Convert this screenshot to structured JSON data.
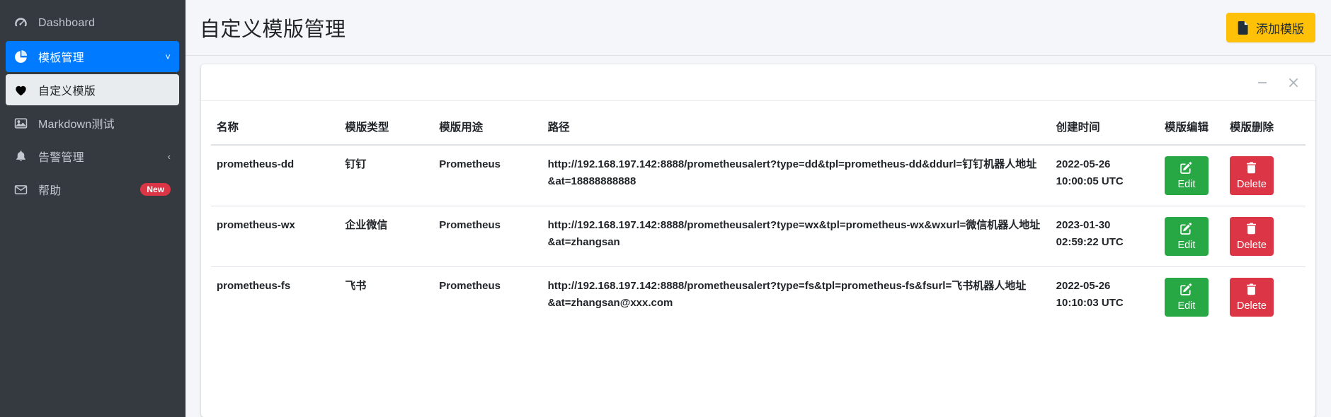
{
  "sidebar": {
    "items": [
      {
        "label": "Dashboard",
        "icon": "dashboard-icon",
        "state": "normal",
        "chevron": "",
        "badge": ""
      },
      {
        "label": "模板管理",
        "icon": "pie-chart-icon",
        "state": "active",
        "chevron": "˅",
        "badge": ""
      },
      {
        "label": "自定义模版",
        "icon": "heart-icon",
        "state": "sub-active",
        "chevron": "",
        "badge": ""
      },
      {
        "label": "Markdown测试",
        "icon": "image-icon",
        "state": "normal",
        "chevron": "",
        "badge": ""
      },
      {
        "label": "告警管理",
        "icon": "bell-icon",
        "state": "normal",
        "chevron": "‹",
        "badge": ""
      },
      {
        "label": "帮助",
        "icon": "mail-icon",
        "state": "normal",
        "chevron": "",
        "badge": "New"
      }
    ]
  },
  "header": {
    "title": "自定义模版管理",
    "add_button_label": "添加模版",
    "add_button_icon": "file-icon",
    "add_button_color": "#ffc107"
  },
  "card": {
    "minimize_icon": "minus-icon",
    "close_icon": "close-icon"
  },
  "table": {
    "columns": [
      "名称",
      "模版类型",
      "模版用途",
      "路径",
      "创建时间",
      "模版编辑",
      "模版删除"
    ],
    "edit_label": "Edit",
    "edit_icon": "pencil-square-icon",
    "edit_color": "#28a745",
    "delete_label": "Delete",
    "delete_icon": "trash-icon",
    "delete_color": "#dc3545",
    "rows": [
      {
        "name": "prometheus-dd",
        "type": "钉钉",
        "use": "Prometheus",
        "path": "http://192.168.197.142:8888/prometheusalert?type=dd&tpl=prometheus-dd&ddurl=钉钉机器人地址&at=18888888888",
        "created": "2022-05-26 10:00:05 UTC"
      },
      {
        "name": "prometheus-wx",
        "type": "企业微信",
        "use": "Prometheus",
        "path": "http://192.168.197.142:8888/prometheusalert?type=wx&tpl=prometheus-wx&wxurl=微信机器人地址&at=zhangsan",
        "created": "2023-01-30 02:59:22 UTC"
      },
      {
        "name": "prometheus-fs",
        "type": "飞书",
        "use": "Prometheus",
        "path": "http://192.168.197.142:8888/prometheusalert?type=fs&tpl=prometheus-fs&fsurl=飞书机器人地址&at=zhangsan@xxx.com",
        "created": "2022-05-26 10:10:03 UTC"
      }
    ]
  }
}
